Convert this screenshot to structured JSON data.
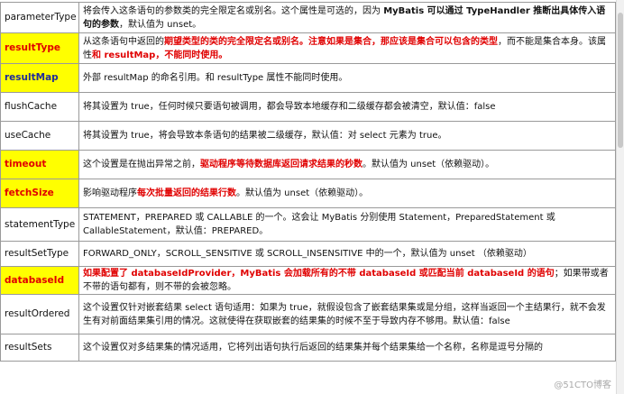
{
  "rows": [
    {
      "name": "parameterType",
      "style": "plain",
      "desc": [
        {
          "t": "将会传入这条语句的参数类的完全限定名或别名。这个属性是可选的，因为 "
        },
        {
          "t": "MyBatis 可以通过 TypeHandler 推断出具体传入语句的参数",
          "b": 1
        },
        {
          "t": "，默认值为 unset。"
        }
      ]
    },
    {
      "name": "resultType",
      "style": "hl",
      "desc": [
        {
          "t": "从这条语句中返回的"
        },
        {
          "t": "期望类型的类的完全限定名或别名。注意如果是集合，那应该是集合可以包含的类型",
          "r": 1
        },
        {
          "t": "，而不能是集合本身。该属性"
        },
        {
          "t": "和 resultMap，不能同时使用。",
          "r": 1
        }
      ]
    },
    {
      "name": "resultMap",
      "style": "hl2",
      "desc": [
        {
          "t": "外部 resultMap 的命名引用。和 resultType 属性不能同时使用。"
        }
      ]
    },
    {
      "name": "flushCache",
      "style": "plain",
      "desc": [
        {
          "t": "将其设置为 true，任何时候只要语句被调用，都会导致本地缓存和二级缓存都会被清空，默认值：false"
        }
      ]
    },
    {
      "name": "useCache",
      "style": "plain",
      "desc": [
        {
          "t": "将其设置为 true，将会导致本条语句的结果被二级缓存，默认值：对 select 元素为 true。"
        }
      ]
    },
    {
      "name": "timeout",
      "style": "hl",
      "desc": [
        {
          "t": "这个设置是在抛出异常之前，"
        },
        {
          "t": "驱动程序等待数据库返回请求结果的秒数",
          "r": 1
        },
        {
          "t": "。默认值为 unset（依赖驱动）。"
        }
      ]
    },
    {
      "name": "fetchSize",
      "style": "hl",
      "desc": [
        {
          "t": "影响驱动程序"
        },
        {
          "t": "每次批量返回的结果行数",
          "r": 1
        },
        {
          "t": "。默认值为 unset（依赖驱动）。"
        }
      ]
    },
    {
      "name": "statementType",
      "style": "plain",
      "desc": [
        {
          "t": "STATEMENT，PREPARED 或 CALLABLE 的一个。这会让 MyBatis 分别使用 Statement，PreparedStatement 或 CallableStatement，默认值：PREPARED。"
        }
      ]
    },
    {
      "name": "resultSetType",
      "style": "plain",
      "desc": [
        {
          "t": "FORWARD_ONLY，SCROLL_SENSITIVE 或 SCROLL_INSENSITIVE 中的一个，默认值为 unset （依赖驱动）"
        }
      ]
    },
    {
      "name": "databaseId",
      "style": "hl",
      "desc": [
        {
          "t": "如果配置了 databaseIdProvider，MyBatis 会加载所有的不带 databaseId 或匹配当前 databaseId 的语句",
          "r": 1
        },
        {
          "t": "；如果带或者不带的语句都有，则不带的会被忽略。"
        }
      ]
    },
    {
      "name": "resultOrdered",
      "style": "plain",
      "desc": [
        {
          "t": "这个设置仅针对嵌套结果 select 语句适用：如果为 true，就假设包含了嵌套结果集或是分组，这样当返回一个主结果行，就不会发生有对前面结果集引用的情况。这就使得在获取嵌套的结果集的时候不至于导致内存不够用。默认值：false"
        }
      ]
    },
    {
      "name": "resultSets",
      "style": "plain",
      "desc": [
        {
          "t": "这个设置仅对多结果集的情况适用，它将列出语句执行后返回的结果集并每个结果集给一个名称，名称是逗号分隔的"
        }
      ]
    }
  ],
  "watermark": "@51CTO博客"
}
